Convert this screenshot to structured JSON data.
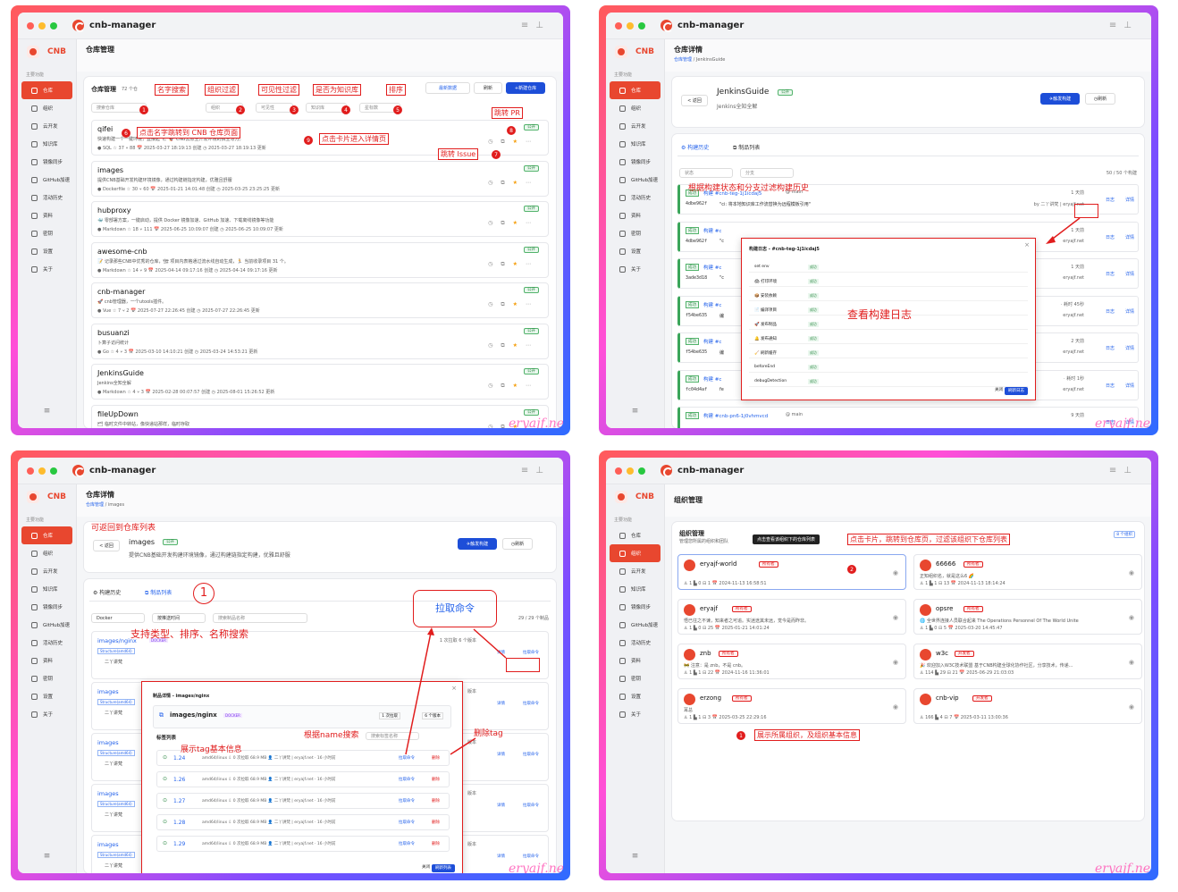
{
  "app": {
    "title": "cnb-manager",
    "brand": "CNB",
    "nav_header": "主要功能",
    "nav": [
      "仓库",
      "组织",
      "云开发",
      "知识库",
      "镜像同步",
      "GitHub加速",
      "活动历史",
      "资料",
      "密钥",
      "设置",
      "关于"
    ],
    "nav_foot": "≡",
    "watermark": "eryajf.net"
  },
  "p1": {
    "page_title": "仓库管理",
    "list_title": "仓库管理",
    "count": "72 个仓",
    "btn_latest": "最新数据",
    "btn_refresh": "刷新",
    "btn_new": "+新建仓库",
    "search_placeholder": "搜索仓库",
    "filters": [
      "组织",
      "可见性",
      "知识库",
      "星标数"
    ],
    "repos": [
      {
        "name": "qifei",
        "desc": "快速构建一个一键环境，直接起飞。🚀 CNB云原生开发环境的搞主写刀。",
        "meta": "● SQL  ☆ 37  ⑂ 88  📅 2025-03-27 18:19:13 创建  ◷ 2025-03-27 18:19:13 更新"
      },
      {
        "name": "images",
        "desc": "提供CNB基础开发构建环境镜像，通过构建链指定构建，优雅且舒服",
        "meta": "● Dockerfile  ☆ 30  ⑂ 60  📅 2025-01-21 14:01:48 创建  ◷ 2025-03-25 23:25:25 更新"
      },
      {
        "name": "hubproxy",
        "desc": "🐳 零部署方案，一键启动，提供 Docker 镜像加速、GitHub 加速、下载离线镜像等功能",
        "meta": "● Markdown  ☆ 18  ⑂ 111  📅 2025-06-25 10:09:07 创建  ◷ 2025-06-25 10:09:07 更新"
      },
      {
        "name": "awesome-cnb",
        "desc": "📝 记录那些CNB中优秀的仓库，🏗 项目内表格通过流水线自动生成，🏃 当前收录项目 31 个。",
        "meta": "● Markdown  ☆ 14  ⑂ 9  📅 2025-04-14 09:17:16 创建  ◷ 2025-04-14 09:17:16 更新"
      },
      {
        "name": "cnb-manager",
        "desc": "🚀 cnb管理器，一个utools插件。",
        "meta": "● Vue  ☆ 7  ⑂ 2  📅 2025-07-27 22:26:45 创建  ◷ 2025-07-27 22:26:45 更新"
      },
      {
        "name": "busuanzi",
        "desc": "卜算子访问统计",
        "meta": "● Go  ☆ 4  ⑂ 3  📅 2025-03-10 14:10:21 创建  ◷ 2025-03-24 14:53:21 更新"
      },
      {
        "name": "JenkinsGuide",
        "desc": "Jenkins全知全解",
        "meta": "● Markdown  ☆ 4  ⑂ 3  📅 2025-02-28 00:07:57 创建  ◷ 2025-08-01 15:26:52 更新"
      },
      {
        "name": "fileUpDown",
        "desc": "🗂 临时文件中转站，像快递站那样，临时存取",
        "meta": ""
      }
    ],
    "badge": "公开",
    "annos": {
      "a1": "名字搜索",
      "a2": "组织过滤",
      "a3": "可见性过滤",
      "a4": "是否为知识库",
      "a5": "排序",
      "a6": "点击名字跳转到 CNB 仓库页面",
      "a7": "跳转 Issue",
      "a8": "跳转 PR",
      "a9": "点击卡片进入详情页"
    },
    "nums": [
      "1",
      "2",
      "3",
      "4",
      "5",
      "6",
      "7",
      "8",
      "9"
    ]
  },
  "p2": {
    "page_title": "仓库详情",
    "crumb_a": "仓库管理",
    "crumb_b": "JenkinsGuide",
    "back": "< 返回",
    "repo_name": "JenkinsGuide",
    "repo_desc": "Jenkins全知全解",
    "badge": "公开",
    "btn_build": "✈触发构建",
    "btn_refresh": "◷刷新",
    "tab1": "⚙ 构建历史",
    "tab2": "⧉ 制品列表",
    "filter1": "状态",
    "filter2": "分支",
    "count": "50 / 50 个构建",
    "anno_filter": "根据构建状态和分支过滤构建历史",
    "anno_log": "查看构建日志",
    "status": "成功",
    "builds": [
      {
        "title": "构建 #cnb-teg-1j1icdaj5",
        "branch": "@ main",
        "hash": "4dbe962f",
        "msg": "\"ci: 将本地知识库工作流替换为远程模板引用\"",
        "time": "1 天前",
        "by": "by 二丫讲梵 | eryajf.net"
      },
      {
        "title": "构建 #c",
        "hash": "4dbe962f",
        "msg": "\"c",
        "time": "1 天前",
        "by": "eryajf.net"
      },
      {
        "title": "构建 #c",
        "hash": "3ade3d18",
        "msg": "\"c",
        "time": "1 天前",
        "by": "eryajf.net"
      },
      {
        "title": "构建 #c",
        "hash": "f54be635",
        "msg": "编",
        "time": "· 耗时 45秒",
        "by": "eryajf.net"
      },
      {
        "title": "构建 #c",
        "hash": "f54be635",
        "msg": "编",
        "time": "2 天前",
        "by": "eryajf.net"
      },
      {
        "title": "构建 #c",
        "hash": "fc04d4af",
        "msg": "fe",
        "time": "· 耗时 1秒",
        "by": "eryajf.net"
      },
      {
        "title": "构建 #cnb-pn6-1j0vhmvcd",
        "branch": "@ main",
        "hash": "",
        "msg": "",
        "time": "9 天前",
        "by": ""
      }
    ],
    "log_btn": "日志",
    "detail_btn": "详情",
    "modal_title": "构建日志 - #cnb-teg-1j1icdaj5",
    "log_steps": [
      "set env",
      "🖨 打印环境",
      "📦 安装依赖",
      "📄 编译项目",
      "🚀 发布制品",
      "🔔 发布通知",
      "🧹 刷新缓存",
      "beforeEnd",
      "debugDetection"
    ],
    "modal_close": "关闭",
    "modal_refresh": "刷新日志"
  },
  "p3": {
    "page_title": "仓库详情",
    "crumb_a": "仓库管理",
    "crumb_b": "images",
    "back": "< 返回",
    "repo_name": "images",
    "repo_desc": "提供CNB基础开发构建环境镜像，通过构建链指定构建，优雅且舒服",
    "badge": "公开",
    "btn_build": "✈触发构建",
    "btn_refresh": "◷刷新",
    "tab1": "⚙ 构建历史",
    "tab2": "⧉ 制品列表",
    "filter1": "Docker",
    "filter2": "按推送时间",
    "search": "搜索制品名称",
    "count": "29 / 29 个制品",
    "img_name": "images/nginx",
    "img_type": "DOCKER",
    "tag_label": "Structure(amd64)",
    "owner": "二丫讲梵",
    "pulls": "1 次拉取  6 个版本",
    "img_short": "images",
    "detail_btn": "详情",
    "pull_btn": "拉取命令",
    "ver": "版本",
    "anno_back": "可返回到仓库列表",
    "anno_search": "支持类型、排序、名称搜索",
    "anno_pull": "拉取命令",
    "anno_name": "根据name搜索",
    "anno_del": "删除tag",
    "anno_tag": "展示tag基本信息",
    "num": "1",
    "modal_title": "制品详情 - images/nginx",
    "modal_name": "images/nginx",
    "modal_type": "DOCKER",
    "modal_pulls": "1 次拉取",
    "modal_vers": "6 个版本",
    "tag_list": "标签列表",
    "tag_search": "搜索标签名称",
    "tags": [
      {
        "tag": "1.24"
      },
      {
        "tag": "1.26"
      },
      {
        "tag": "1.27"
      },
      {
        "tag": "1.28"
      },
      {
        "tag": "1.29"
      }
    ],
    "tag_info": "amd64/linux  ⇩ 0 次拉取  68.9 MB  👤 二丫讲梵 | eryajf.net · 16 小时前",
    "tag_pull": "拉取命令",
    "tag_del": "删除",
    "modal_close": "关闭",
    "modal_refresh": "刷新列表"
  },
  "p4": {
    "page_title": "组织管理",
    "card_title": "组织管理",
    "card_sub": "管理您所属的组织和团队",
    "count": "8 个组织",
    "tooltip": "点击查看该组织下的仓库列表",
    "anno_click": "点击卡片，跳转到仓库页，过滤该组织下仓库列表",
    "anno_show": "展示所属组织，及组织基本信息",
    "n1": "1",
    "n2": "2",
    "orgs": [
      {
        "name": "eryajf-world",
        "badge": "所有者",
        "desc": "",
        "meta": "♙ 1  ▙ 0  ⊟ 1  📅 2024-11-13 16:58:51"
      },
      {
        "name": "66666",
        "badge": "所有者",
        "desc": "正知组织名，就是这么6 🌈",
        "meta": "♙ 1  ▙ 1  ⊟ 13  📅 2024-11-13 18:14:24"
      },
      {
        "name": "eryajf",
        "badge": "所有者",
        "desc": "悟已往之不谏，知来者之可追。实迷途其未远，觉今是而昨非。",
        "meta": "♙ 1  ▙ 0  ⊟ 25  📅 2025-01-21 14:01:24"
      },
      {
        "name": "opsre",
        "badge": "所有者",
        "desc": "🌐 全世界连接人员联合起来 The Operations Personnel Of The World Unite",
        "meta": "♙ 1  ▙ 0  ⊟ 5  📅 2025-03-20 14:45:47"
      },
      {
        "name": "znb",
        "badge": "所有者",
        "desc": "🚧 注意：是 znb，不是 cnb。",
        "meta": "♙ 1  ▙ 1  ⊟ 22  📅 2024-11-16 11:36:01"
      },
      {
        "name": "w3c",
        "badge": "开发者",
        "desc": "🎉 欢迎加入W3C技术联盟 基于CNB构建全球化协作社区，分享技术，传递...",
        "meta": "♙ 114  ▙ 29  ⊟ 21  📅 2025-06-29 21:03:03"
      },
      {
        "name": "erzong",
        "badge": "所有者",
        "desc": "耳总",
        "meta": "♙ 1  ▙ 1  ⊟ 3  📅 2025-03-25 22:29:16"
      },
      {
        "name": "cnb-vip",
        "badge": "开发者",
        "desc": "",
        "meta": "♙ 166  ▙ 4  ⊟ 7  📅 2025-03-11 13:00:36"
      }
    ]
  }
}
